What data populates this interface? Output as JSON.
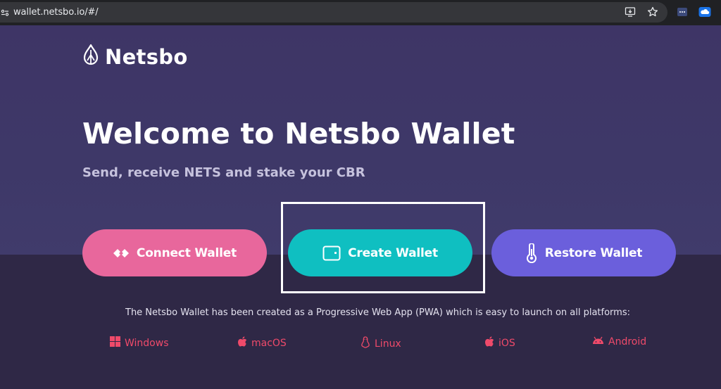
{
  "browser": {
    "url": "wallet.netsbo.io/#/"
  },
  "page": {
    "logo_text": "Netsbo",
    "title": "Welcome to Netsbo Wallet",
    "subtitle": "Send, receive NETS and stake your CBR",
    "buttons": {
      "connect": "Connect Wallet",
      "create": "Create Wallet",
      "restore": "Restore Wallet"
    },
    "pwa_text": "The Netsbo Wallet has been created as a Progressive Web App (PWA) which is easy to launch on all platforms:",
    "platforms": [
      {
        "label": "Windows",
        "icon": "windows-icon"
      },
      {
        "label": "macOS",
        "icon": "apple-icon"
      },
      {
        "label": "Linux",
        "icon": "linux-icon"
      },
      {
        "label": "iOS",
        "icon": "apple-icon"
      },
      {
        "label": "Android",
        "icon": "android-icon"
      }
    ]
  },
  "colors": {
    "hero_bg": "#3e3566",
    "lower_bg": "#2f2846",
    "connect": "#e8679c",
    "create": "#0fbfc1",
    "restore": "#6b5fdc",
    "platform_link": "#ef4a6a"
  }
}
